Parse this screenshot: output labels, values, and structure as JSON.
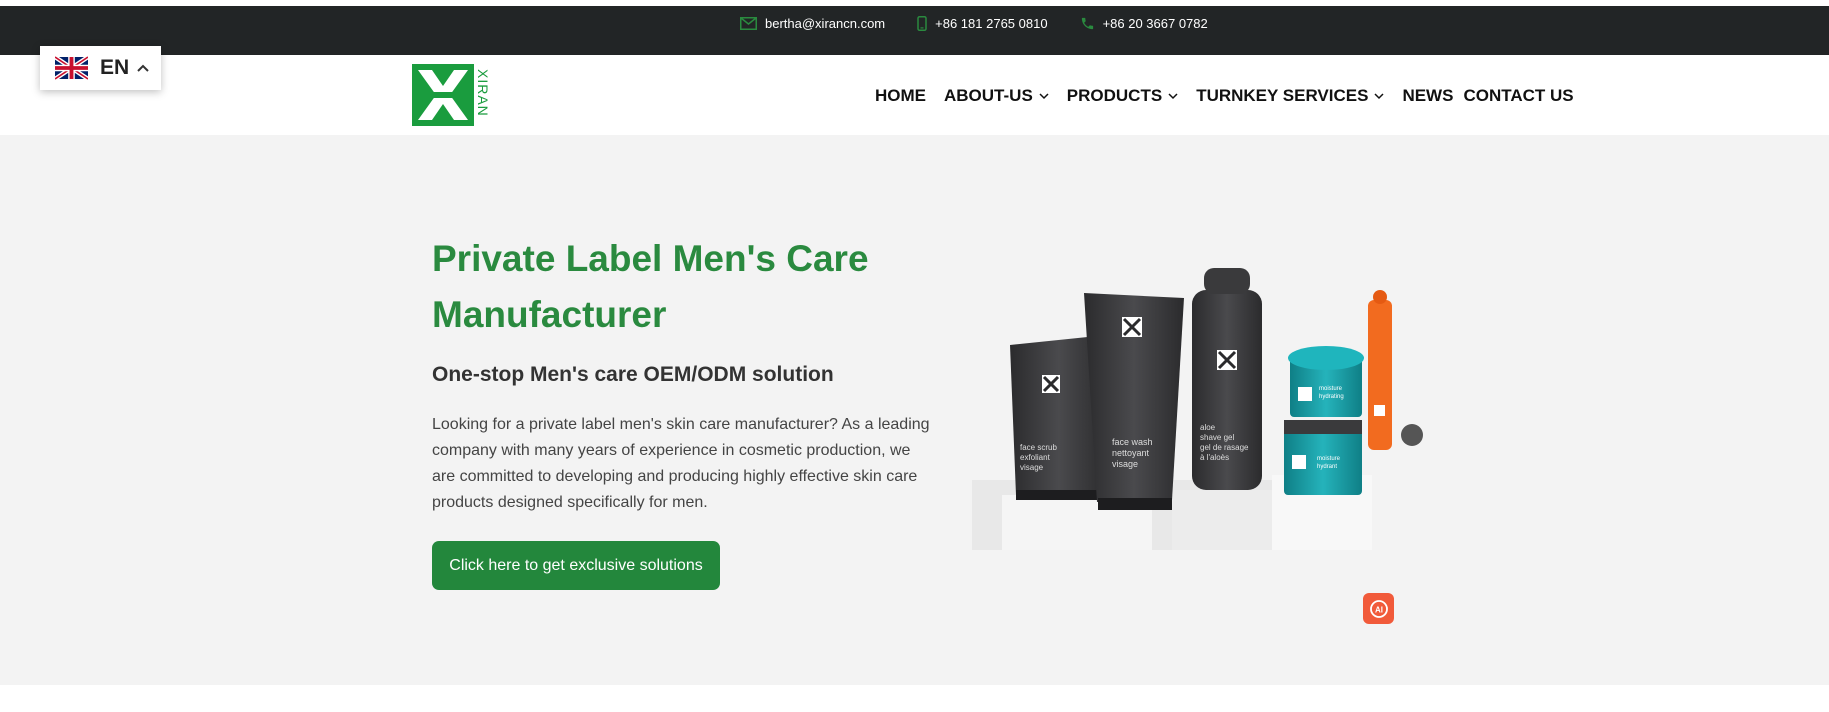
{
  "topbar": {
    "email": "bertha@xirancn.com",
    "mobile": "+86 181 2765 0810",
    "phone": "+86 20 3667 0782",
    "icon_color": "#2a8a3f"
  },
  "language": {
    "code": "EN",
    "flag": "uk-flag-icon"
  },
  "logo": {
    "text": "XIRAN",
    "color": "#1a9c3e"
  },
  "nav": {
    "items": [
      {
        "label": "HOME",
        "dropdown": false
      },
      {
        "label": "ABOUT-US",
        "dropdown": true
      },
      {
        "label": "PRODUCTS",
        "dropdown": true
      },
      {
        "label": "TURNKEY SERVICES",
        "dropdown": true
      },
      {
        "label": "NEWS",
        "dropdown": false
      },
      {
        "label": "CONTACT US",
        "dropdown": false
      }
    ]
  },
  "hero": {
    "title": "Private Label Men's Care Manufacturer",
    "subtitle": "One-stop Men's care OEM/ODM solution",
    "description": "Looking for a private label men's skin care manufacturer? As a leading company with many years of experience in cosmetic production, we are committed to developing and producing highly effective skin care products designed specifically for men.",
    "cta": "Click here to get exclusive solutions",
    "accent_color": "#2a8a3f"
  },
  "products": {
    "scrub": [
      "face scrub",
      "exfoliant",
      "visage"
    ],
    "wash": [
      "face wash",
      "nettoyant",
      "visage"
    ],
    "shave": [
      "aloe",
      "shave gel",
      "gel de rasage",
      "à l'aloès"
    ],
    "jar_top": [
      "moisture",
      "hydrating"
    ],
    "jar_bottom": [
      "moisture",
      "hydrant"
    ]
  },
  "ai_badge": {
    "label": "AI"
  }
}
